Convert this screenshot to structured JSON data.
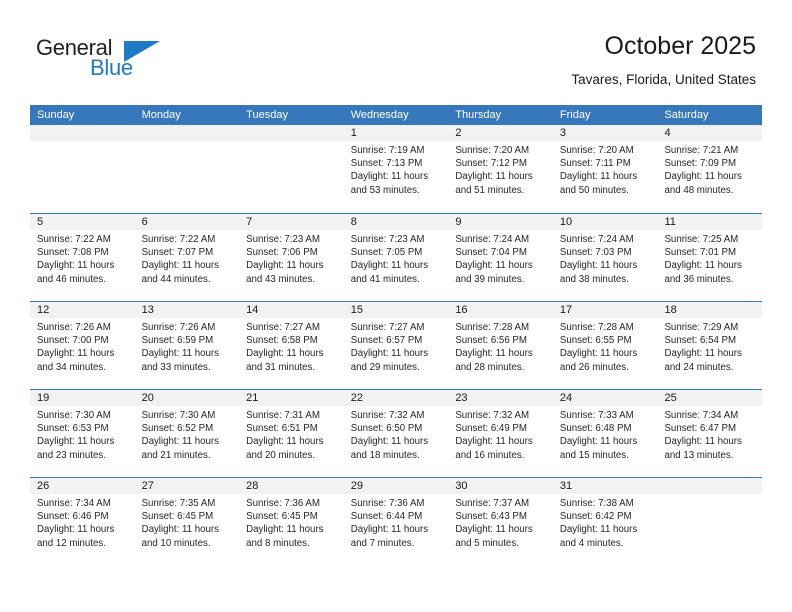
{
  "logo": {
    "word_top": "General",
    "word_bottom": "Blue",
    "accent_color": "#1f7bc4"
  },
  "header": {
    "title": "October 2025",
    "subtitle": "Tavares, Florida, United States"
  },
  "calendar": {
    "header_color": "#3778bc",
    "weekdays": [
      "Sunday",
      "Monday",
      "Tuesday",
      "Wednesday",
      "Thursday",
      "Friday",
      "Saturday"
    ],
    "weeks": [
      [
        {
          "day": "",
          "empty": true
        },
        {
          "day": "",
          "empty": true
        },
        {
          "day": "",
          "empty": true
        },
        {
          "day": "1",
          "sunrise": "Sunrise: 7:19 AM",
          "sunset": "Sunset: 7:13 PM",
          "daylight1": "Daylight: 11 hours",
          "daylight2": "and 53 minutes."
        },
        {
          "day": "2",
          "sunrise": "Sunrise: 7:20 AM",
          "sunset": "Sunset: 7:12 PM",
          "daylight1": "Daylight: 11 hours",
          "daylight2": "and 51 minutes."
        },
        {
          "day": "3",
          "sunrise": "Sunrise: 7:20 AM",
          "sunset": "Sunset: 7:11 PM",
          "daylight1": "Daylight: 11 hours",
          "daylight2": "and 50 minutes."
        },
        {
          "day": "4",
          "sunrise": "Sunrise: 7:21 AM",
          "sunset": "Sunset: 7:09 PM",
          "daylight1": "Daylight: 11 hours",
          "daylight2": "and 48 minutes."
        }
      ],
      [
        {
          "day": "5",
          "sunrise": "Sunrise: 7:22 AM",
          "sunset": "Sunset: 7:08 PM",
          "daylight1": "Daylight: 11 hours",
          "daylight2": "and 46 minutes."
        },
        {
          "day": "6",
          "sunrise": "Sunrise: 7:22 AM",
          "sunset": "Sunset: 7:07 PM",
          "daylight1": "Daylight: 11 hours",
          "daylight2": "and 44 minutes."
        },
        {
          "day": "7",
          "sunrise": "Sunrise: 7:23 AM",
          "sunset": "Sunset: 7:06 PM",
          "daylight1": "Daylight: 11 hours",
          "daylight2": "and 43 minutes."
        },
        {
          "day": "8",
          "sunrise": "Sunrise: 7:23 AM",
          "sunset": "Sunset: 7:05 PM",
          "daylight1": "Daylight: 11 hours",
          "daylight2": "and 41 minutes."
        },
        {
          "day": "9",
          "sunrise": "Sunrise: 7:24 AM",
          "sunset": "Sunset: 7:04 PM",
          "daylight1": "Daylight: 11 hours",
          "daylight2": "and 39 minutes."
        },
        {
          "day": "10",
          "sunrise": "Sunrise: 7:24 AM",
          "sunset": "Sunset: 7:03 PM",
          "daylight1": "Daylight: 11 hours",
          "daylight2": "and 38 minutes."
        },
        {
          "day": "11",
          "sunrise": "Sunrise: 7:25 AM",
          "sunset": "Sunset: 7:01 PM",
          "daylight1": "Daylight: 11 hours",
          "daylight2": "and 36 minutes."
        }
      ],
      [
        {
          "day": "12",
          "sunrise": "Sunrise: 7:26 AM",
          "sunset": "Sunset: 7:00 PM",
          "daylight1": "Daylight: 11 hours",
          "daylight2": "and 34 minutes."
        },
        {
          "day": "13",
          "sunrise": "Sunrise: 7:26 AM",
          "sunset": "Sunset: 6:59 PM",
          "daylight1": "Daylight: 11 hours",
          "daylight2": "and 33 minutes."
        },
        {
          "day": "14",
          "sunrise": "Sunrise: 7:27 AM",
          "sunset": "Sunset: 6:58 PM",
          "daylight1": "Daylight: 11 hours",
          "daylight2": "and 31 minutes."
        },
        {
          "day": "15",
          "sunrise": "Sunrise: 7:27 AM",
          "sunset": "Sunset: 6:57 PM",
          "daylight1": "Daylight: 11 hours",
          "daylight2": "and 29 minutes."
        },
        {
          "day": "16",
          "sunrise": "Sunrise: 7:28 AM",
          "sunset": "Sunset: 6:56 PM",
          "daylight1": "Daylight: 11 hours",
          "daylight2": "and 28 minutes."
        },
        {
          "day": "17",
          "sunrise": "Sunrise: 7:28 AM",
          "sunset": "Sunset: 6:55 PM",
          "daylight1": "Daylight: 11 hours",
          "daylight2": "and 26 minutes."
        },
        {
          "day": "18",
          "sunrise": "Sunrise: 7:29 AM",
          "sunset": "Sunset: 6:54 PM",
          "daylight1": "Daylight: 11 hours",
          "daylight2": "and 24 minutes."
        }
      ],
      [
        {
          "day": "19",
          "sunrise": "Sunrise: 7:30 AM",
          "sunset": "Sunset: 6:53 PM",
          "daylight1": "Daylight: 11 hours",
          "daylight2": "and 23 minutes."
        },
        {
          "day": "20",
          "sunrise": "Sunrise: 7:30 AM",
          "sunset": "Sunset: 6:52 PM",
          "daylight1": "Daylight: 11 hours",
          "daylight2": "and 21 minutes."
        },
        {
          "day": "21",
          "sunrise": "Sunrise: 7:31 AM",
          "sunset": "Sunset: 6:51 PM",
          "daylight1": "Daylight: 11 hours",
          "daylight2": "and 20 minutes."
        },
        {
          "day": "22",
          "sunrise": "Sunrise: 7:32 AM",
          "sunset": "Sunset: 6:50 PM",
          "daylight1": "Daylight: 11 hours",
          "daylight2": "and 18 minutes."
        },
        {
          "day": "23",
          "sunrise": "Sunrise: 7:32 AM",
          "sunset": "Sunset: 6:49 PM",
          "daylight1": "Daylight: 11 hours",
          "daylight2": "and 16 minutes."
        },
        {
          "day": "24",
          "sunrise": "Sunrise: 7:33 AM",
          "sunset": "Sunset: 6:48 PM",
          "daylight1": "Daylight: 11 hours",
          "daylight2": "and 15 minutes."
        },
        {
          "day": "25",
          "sunrise": "Sunrise: 7:34 AM",
          "sunset": "Sunset: 6:47 PM",
          "daylight1": "Daylight: 11 hours",
          "daylight2": "and 13 minutes."
        }
      ],
      [
        {
          "day": "26",
          "sunrise": "Sunrise: 7:34 AM",
          "sunset": "Sunset: 6:46 PM",
          "daylight1": "Daylight: 11 hours",
          "daylight2": "and 12 minutes."
        },
        {
          "day": "27",
          "sunrise": "Sunrise: 7:35 AM",
          "sunset": "Sunset: 6:45 PM",
          "daylight1": "Daylight: 11 hours",
          "daylight2": "and 10 minutes."
        },
        {
          "day": "28",
          "sunrise": "Sunrise: 7:36 AM",
          "sunset": "Sunset: 6:45 PM",
          "daylight1": "Daylight: 11 hours",
          "daylight2": "and 8 minutes."
        },
        {
          "day": "29",
          "sunrise": "Sunrise: 7:36 AM",
          "sunset": "Sunset: 6:44 PM",
          "daylight1": "Daylight: 11 hours",
          "daylight2": "and 7 minutes."
        },
        {
          "day": "30",
          "sunrise": "Sunrise: 7:37 AM",
          "sunset": "Sunset: 6:43 PM",
          "daylight1": "Daylight: 11 hours",
          "daylight2": "and 5 minutes."
        },
        {
          "day": "31",
          "sunrise": "Sunrise: 7:38 AM",
          "sunset": "Sunset: 6:42 PM",
          "daylight1": "Daylight: 11 hours",
          "daylight2": "and 4 minutes."
        },
        {
          "day": "",
          "empty": true
        }
      ]
    ]
  }
}
